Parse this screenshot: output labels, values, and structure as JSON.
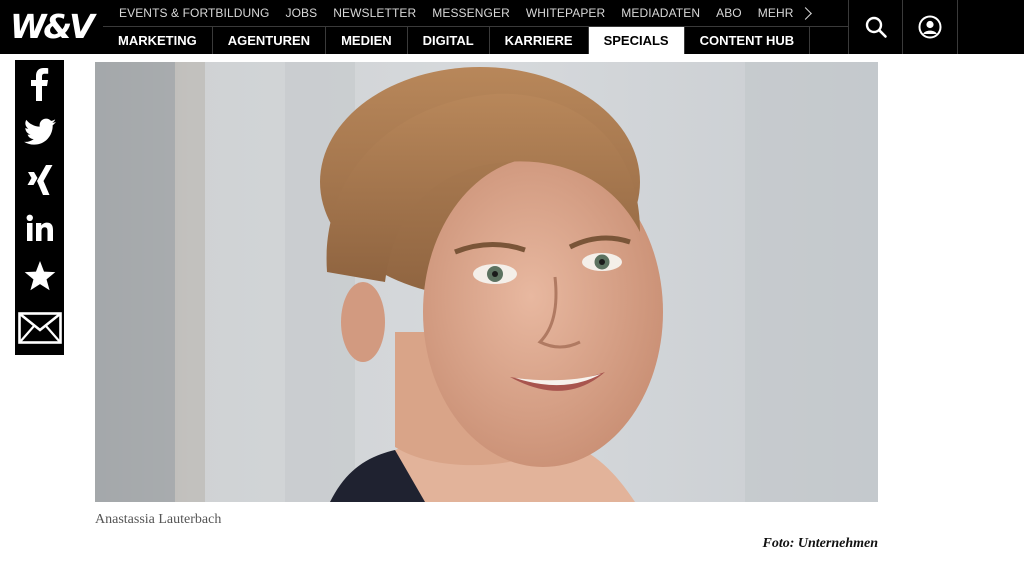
{
  "brand": {
    "logo_text": "W&V"
  },
  "top_nav": [
    {
      "label": "EVENTS & FORTBILDUNG"
    },
    {
      "label": "JOBS"
    },
    {
      "label": "NEWSLETTER"
    },
    {
      "label": "MESSENGER"
    },
    {
      "label": "WHITEPAPER"
    },
    {
      "label": "MEDIADATEN"
    },
    {
      "label": "ABO"
    },
    {
      "label": "MEHR"
    }
  ],
  "main_nav": [
    {
      "label": "MARKETING"
    },
    {
      "label": "AGENTUREN"
    },
    {
      "label": "MEDIEN"
    },
    {
      "label": "DIGITAL"
    },
    {
      "label": "KARRIERE"
    },
    {
      "label": "SPECIALS",
      "active": true
    },
    {
      "label": "CONTENT HUB"
    }
  ],
  "header_icons": [
    "search-icon",
    "user-account-icon"
  ],
  "share_bar": [
    "facebook-icon",
    "twitter-icon",
    "xing-icon",
    "linkedin-icon",
    "star-icon",
    "mail-icon"
  ],
  "article": {
    "image_caption": "Anastassia Lauterbach",
    "image_credit": "Foto: Unternehmen"
  },
  "colors": {
    "header_bg": "#000000",
    "active_tab_bg": "#ffffff",
    "text_muted": "#555555"
  }
}
